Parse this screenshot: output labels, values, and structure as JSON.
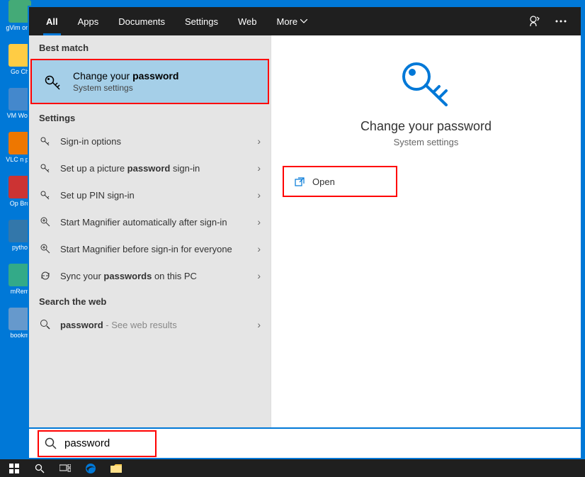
{
  "tabs": {
    "all": "All",
    "apps": "Apps",
    "documents": "Documents",
    "settings": "Settings",
    "web": "Web",
    "more": "More"
  },
  "sections": {
    "best_match": "Best match",
    "settings": "Settings",
    "search_web": "Search the web"
  },
  "best_match": {
    "title_prefix": "Change your ",
    "title_bold": "password",
    "subtitle": "System settings"
  },
  "settings_results": [
    {
      "text": "Sign-in options",
      "bold": ""
    },
    {
      "text_pre": "Set up a picture ",
      "bold": "password",
      "text_post": " sign-in"
    },
    {
      "text": "Set up PIN sign-in",
      "bold": ""
    },
    {
      "text": "Start Magnifier automatically after sign-in",
      "bold": ""
    },
    {
      "text": "Start Magnifier before sign-in for everyone",
      "bold": ""
    },
    {
      "text_pre": "Sync your ",
      "bold": "passwords",
      "text_post": " on this PC",
      "sync": true
    }
  ],
  "web_result": {
    "bold": "password",
    "suffix": " - See web results"
  },
  "detail": {
    "title": "Change your password",
    "subtitle": "System settings",
    "action": "Open"
  },
  "search": {
    "value": "password"
  },
  "desktop_icons": [
    "gVim only",
    "Go Ch",
    "VM Work",
    "VLC n pla",
    "Op Bro",
    "pytho",
    "mRem",
    "bookm"
  ]
}
